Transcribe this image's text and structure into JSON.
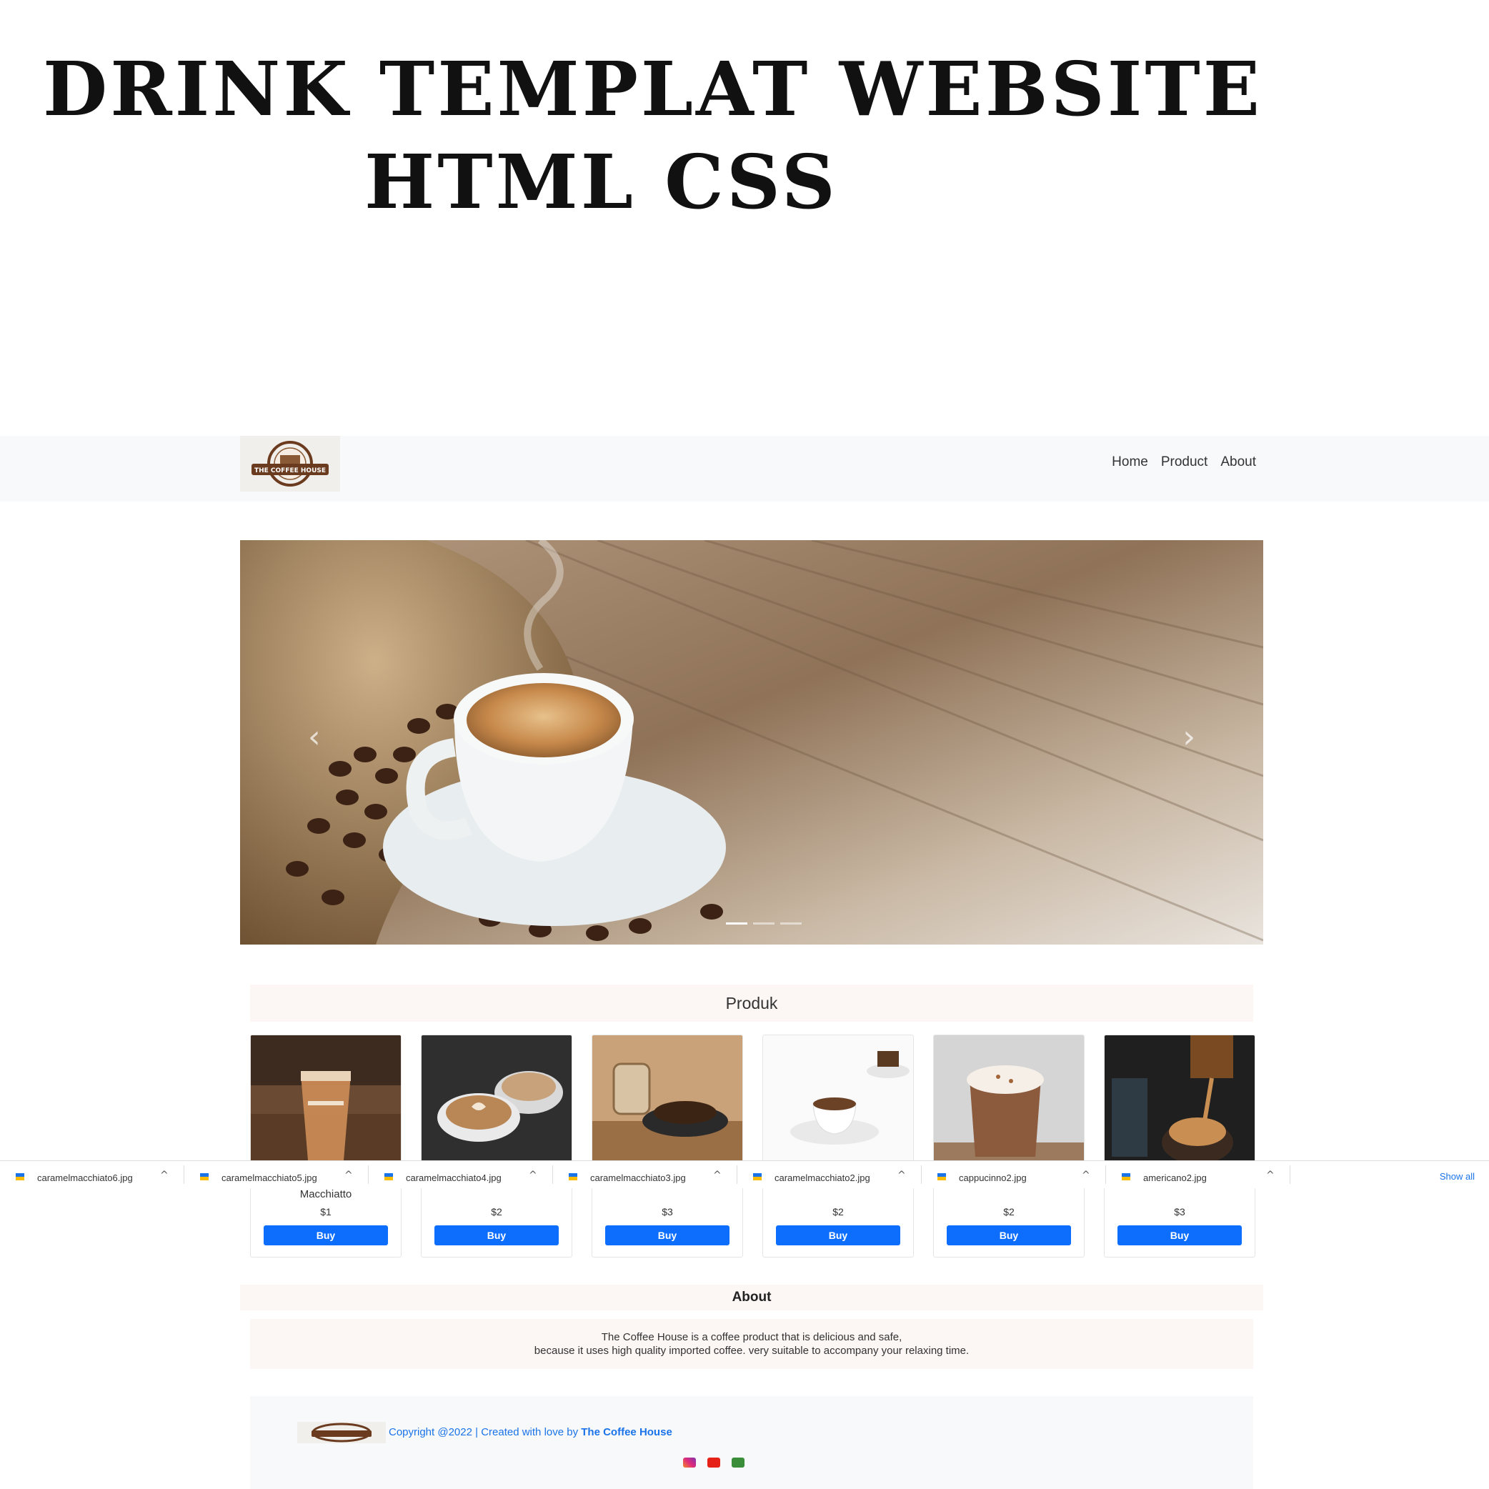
{
  "promo": {
    "line1": "Drink Templat Website",
    "line2": "HTML CSS"
  },
  "navbar": {
    "logo_text": "THE COFFEE HOUSE",
    "links": [
      "Home",
      "Product",
      "About"
    ]
  },
  "hero": {
    "prev_icon": "‹",
    "next_icon": "›",
    "slides": 3,
    "active_slide": 1
  },
  "produk": {
    "title": "Produk",
    "products": [
      {
        "name": "Macchiatto",
        "price": "$1",
        "buy": "Buy"
      },
      {
        "name": "",
        "price": "$2",
        "buy": "Buy"
      },
      {
        "name": "",
        "price": "$3",
        "buy": "Buy"
      },
      {
        "name": "",
        "price": "$2",
        "buy": "Buy"
      },
      {
        "name": "",
        "price": "$2",
        "buy": "Buy"
      },
      {
        "name": "",
        "price": "$3",
        "buy": "Buy"
      }
    ]
  },
  "downloads": {
    "files": [
      "caramelmacchiato6.jpg",
      "caramelmacchiato5.jpg",
      "caramelmacchiato4.jpg",
      "caramelmacchiato3.jpg",
      "caramelmacchiato2.jpg",
      "cappucinno2.jpg",
      "americano2.jpg"
    ],
    "chevron": "^",
    "show_all": "Show all"
  },
  "about": {
    "title": "About",
    "line1": "The Coffee House is a coffee product that is delicious and safe,",
    "line2": "because it uses high quality imported coffee. very suitable to accompany your relaxing time."
  },
  "footer": {
    "copyright": "Copyright @2022 | Created with love by ",
    "brand": "The Coffee House",
    "social": [
      "instagram-icon",
      "youtube-icon",
      "whatsapp-icon"
    ]
  },
  "colors": {
    "primary": "#0d6efd",
    "link": "#1a73e8",
    "section_bg": "#fcf6f4",
    "navbar_bg": "#f8f9fa"
  }
}
